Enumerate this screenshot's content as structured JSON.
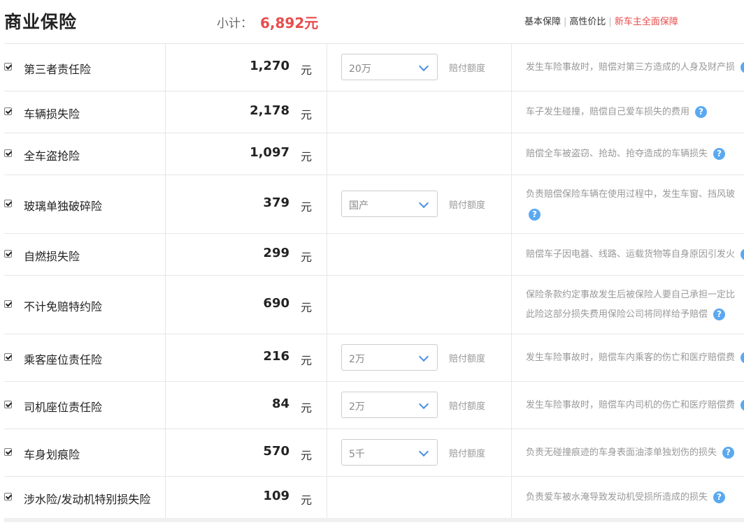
{
  "header": {
    "title": "商业保险",
    "subtotal_label": "小计：",
    "subtotal_value": "6,892元",
    "plans": [
      "基本保障",
      "高性价比",
      "新车主全面保障"
    ],
    "active_plan_color": "#e84c4c"
  },
  "common": {
    "unit": "元",
    "amount_label": "赔付额度",
    "help_icon": "?"
  },
  "rows": [
    {
      "name": "第三者责任险",
      "price": "1,270",
      "checked": true,
      "select": "20万",
      "desc1": "发生车险事故时，赔偿对第三方造成的人身及财产损",
      "desc2": ""
    },
    {
      "name": "车辆损失险",
      "price": "2,178",
      "checked": true,
      "select": "",
      "desc1": "车子发生碰撞，赔偿自己爱车损失的费用",
      "desc2": ""
    },
    {
      "name": "全车盗抢险",
      "price": "1,097",
      "checked": true,
      "select": "",
      "desc1": "赔偿全车被盗窃、抢劫、抢夺造成的车辆损失",
      "desc2": ""
    },
    {
      "name": "玻璃单独破碎险",
      "price": "379",
      "checked": true,
      "select": "国产",
      "desc1": "负责赔偿保险车辆在使用过程中，发生车窗、挡风玻",
      "desc2": ""
    },
    {
      "name": "自燃损失险",
      "price": "299",
      "checked": true,
      "select": "",
      "desc1": "赔偿车子因电器、线路、运载货物等自身原因引发火",
      "desc2": ""
    },
    {
      "name": "不计免赔特约险",
      "price": "690",
      "checked": true,
      "select": "",
      "desc1": "保险条款约定事故发生后被保险人要自己承担一定比",
      "desc2": "此险这部分损失费用保险公司将同样给予赔偿"
    },
    {
      "name": "乘客座位责任险",
      "price": "216",
      "checked": true,
      "select": "2万",
      "desc1": "发生车险事故时，赔偿车内乘客的伤亡和医疗赔偿费",
      "desc2": ""
    },
    {
      "name": "司机座位责任险",
      "price": "84",
      "checked": true,
      "select": "2万",
      "desc1": "发生车险事故时，赔偿车内司机的伤亡和医疗赔偿费",
      "desc2": ""
    },
    {
      "name": "车身划痕险",
      "price": "570",
      "checked": true,
      "select": "5千",
      "desc1": "负责无碰撞痕迹的车身表面油漆单独划伤的损失",
      "desc2": ""
    },
    {
      "name": "涉水险/发动机特别损失险",
      "price": "109",
      "checked": true,
      "select": "",
      "desc1": "负责爱车被水淹导致发动机受损所造成的损失",
      "desc2": ""
    }
  ]
}
